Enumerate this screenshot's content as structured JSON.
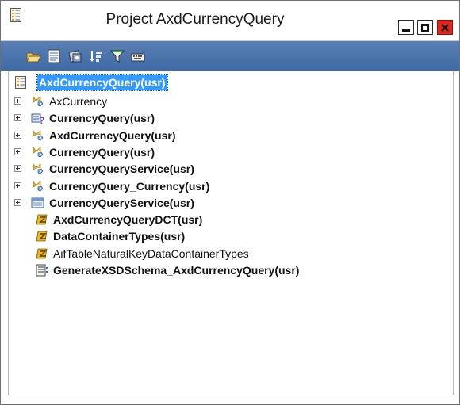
{
  "window": {
    "title": "Project AxdCurrencyQuery",
    "controls": [
      "minimize",
      "maximize",
      "close"
    ]
  },
  "toolbar": {
    "buttons": [
      {
        "name": "open-folder-icon"
      },
      {
        "name": "properties-icon"
      },
      {
        "name": "compile-icon"
      },
      {
        "name": "sort-icon"
      },
      {
        "name": "filter-icon"
      },
      {
        "name": "keyboard-icon"
      }
    ]
  },
  "tree": {
    "root": {
      "label": "AxdCurrencyQuery(usr)",
      "selected": true
    },
    "items": [
      {
        "label": "AxCurrency",
        "bold": false,
        "expandable": true,
        "icon": "class-icon"
      },
      {
        "label": "CurrencyQuery(usr)",
        "bold": true,
        "expandable": true,
        "icon": "query-icon"
      },
      {
        "label": "AxdCurrencyQuery(usr)",
        "bold": true,
        "expandable": true,
        "icon": "class-icon"
      },
      {
        "label": "CurrencyQuery(usr)",
        "bold": true,
        "expandable": true,
        "icon": "class-icon"
      },
      {
        "label": "CurrencyQueryService(usr)",
        "bold": true,
        "expandable": true,
        "icon": "class-icon"
      },
      {
        "label": "CurrencyQuery_Currency(usr)",
        "bold": true,
        "expandable": true,
        "icon": "class-icon"
      },
      {
        "label": "CurrencyQueryService(usr)",
        "bold": true,
        "expandable": true,
        "icon": "service-icon"
      },
      {
        "label": "AxdCurrencyQueryDCT(usr)",
        "bold": true,
        "expandable": false,
        "icon": "macro-icon"
      },
      {
        "label": "DataContainerTypes(usr)",
        "bold": true,
        "expandable": false,
        "icon": "macro-icon"
      },
      {
        "label": "AifTableNaturalKeyDataContainerTypes",
        "bold": false,
        "expandable": false,
        "icon": "macro-icon"
      },
      {
        "label": "GenerateXSDSchema_AxdCurrencyQuery(usr)",
        "bold": true,
        "expandable": false,
        "icon": "job-icon"
      }
    ]
  },
  "colors": {
    "toolbar": "#4a73ad",
    "selection": "#3399ff",
    "close": "#e3241b"
  }
}
